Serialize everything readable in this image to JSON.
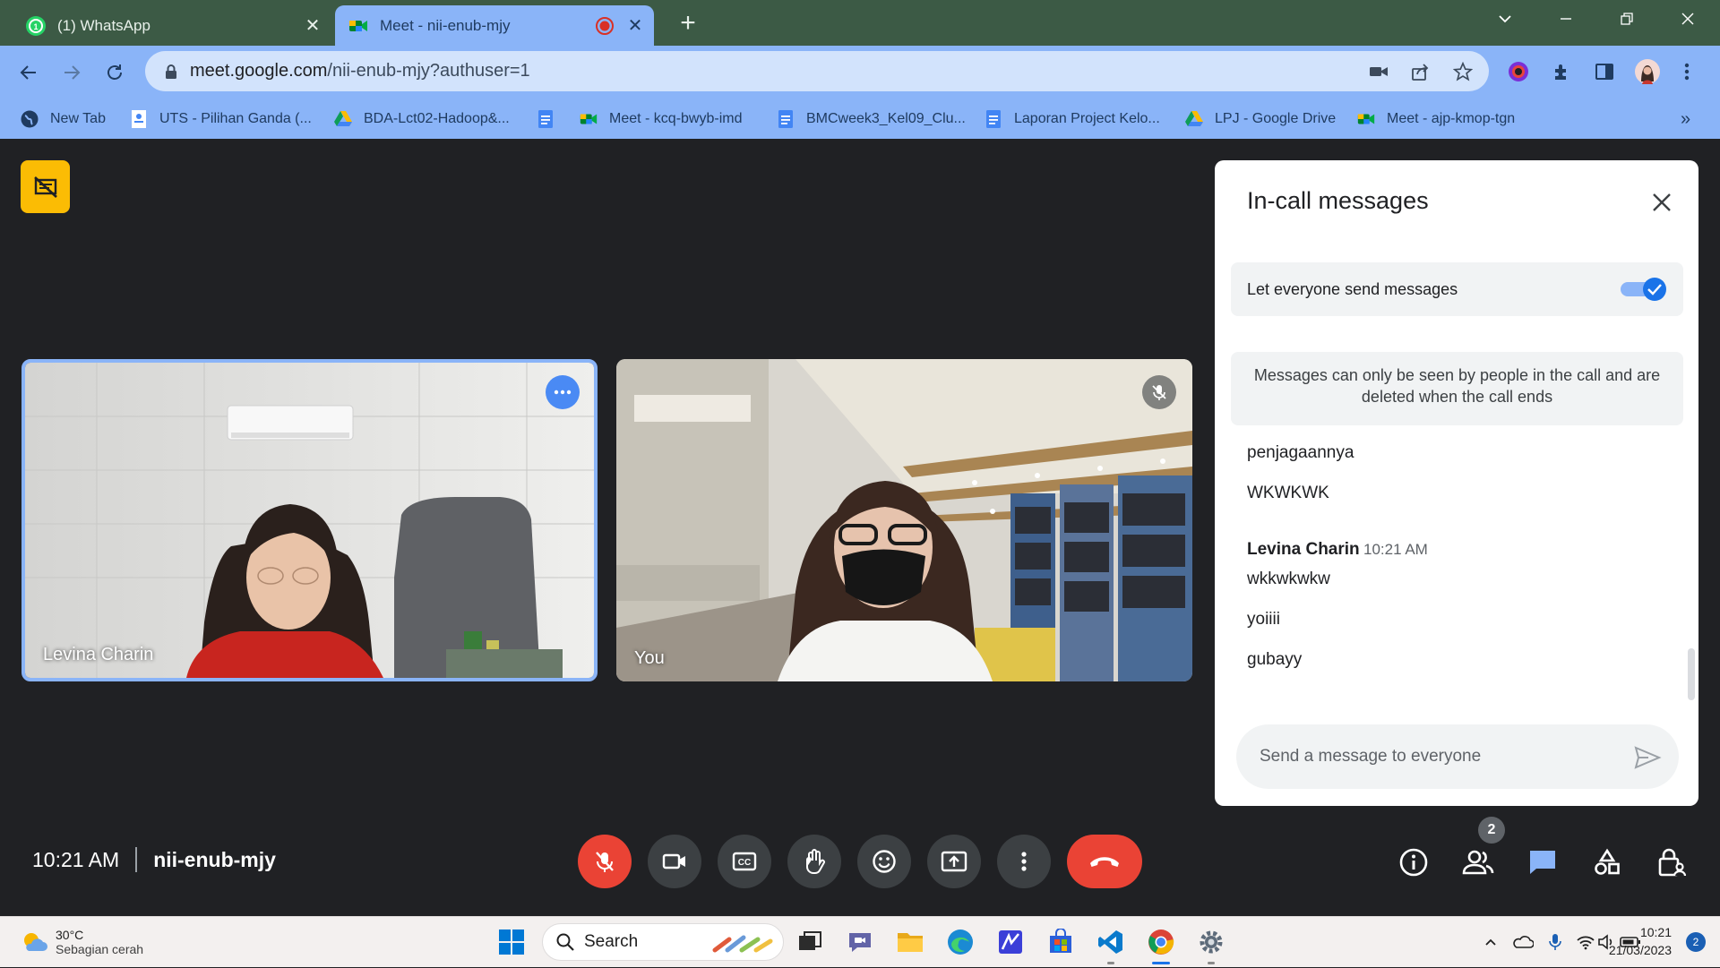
{
  "browser": {
    "tabs": [
      {
        "title": "(1) WhatsApp",
        "active": false
      },
      {
        "title": "Meet - nii-enub-mjy",
        "active": true,
        "recording": true
      }
    ],
    "url": {
      "host": "meet.google.com",
      "path": "/nii-enub-mjy?authuser=1"
    },
    "bookmarks": [
      {
        "label": "New Tab",
        "icon": "globe-icon"
      },
      {
        "label": "UTS - Pilihan Ganda (...",
        "icon": "document-icon"
      },
      {
        "label": "BDA-Lct02-Hadoop&...",
        "icon": "drive-icon"
      },
      {
        "label": "",
        "icon": "docs-icon"
      },
      {
        "label": "Meet - kcq-bwyb-imd",
        "icon": "meet-icon"
      },
      {
        "label": "BMCweek3_Kel09_Clu...",
        "icon": "docs-icon"
      },
      {
        "label": "Laporan Project Kelo...",
        "icon": "docs-icon"
      },
      {
        "label": "LPJ - Google Drive",
        "icon": "drive-icon"
      },
      {
        "label": "Meet - ajp-kmop-tgn",
        "icon": "meet-icon"
      }
    ],
    "more_bookmarks": "»"
  },
  "meet": {
    "participants": [
      {
        "name": "Levina Charin",
        "active_speaker": true
      },
      {
        "name": "You",
        "muted": true
      }
    ],
    "time": "10:21 AM",
    "meeting_code": "nii-enub-mjy",
    "people_count": "2",
    "mic_muted": true
  },
  "chat": {
    "title": "In-call messages",
    "toggle_label": "Let everyone send messages",
    "toggle_on": true,
    "notice": "Messages can only be seen by people in the call and are deleted when the call ends",
    "earlier_messages": [
      "penjagaannya",
      "WKWKWK"
    ],
    "group": {
      "sender": "Levina Charin",
      "time": "10:21 AM",
      "messages": [
        "wkkwkwkw",
        "yoiiii",
        "gubayy"
      ]
    },
    "input_placeholder": "Send a message to everyone"
  },
  "taskbar": {
    "weather": {
      "temp": "30°C",
      "desc": "Sebagian cerah"
    },
    "search_label": "Search",
    "clock_time": "10:21",
    "clock_date": "21/03/2023",
    "notifications": "2"
  },
  "colors": {
    "tab_bar": "#3c5a45",
    "toolbar": "#8ab4f8",
    "meet_bg": "#202124",
    "accent_blue": "#1a73e8",
    "end_call_red": "#ea4335",
    "pin_badge_yellow": "#fbbc04"
  }
}
